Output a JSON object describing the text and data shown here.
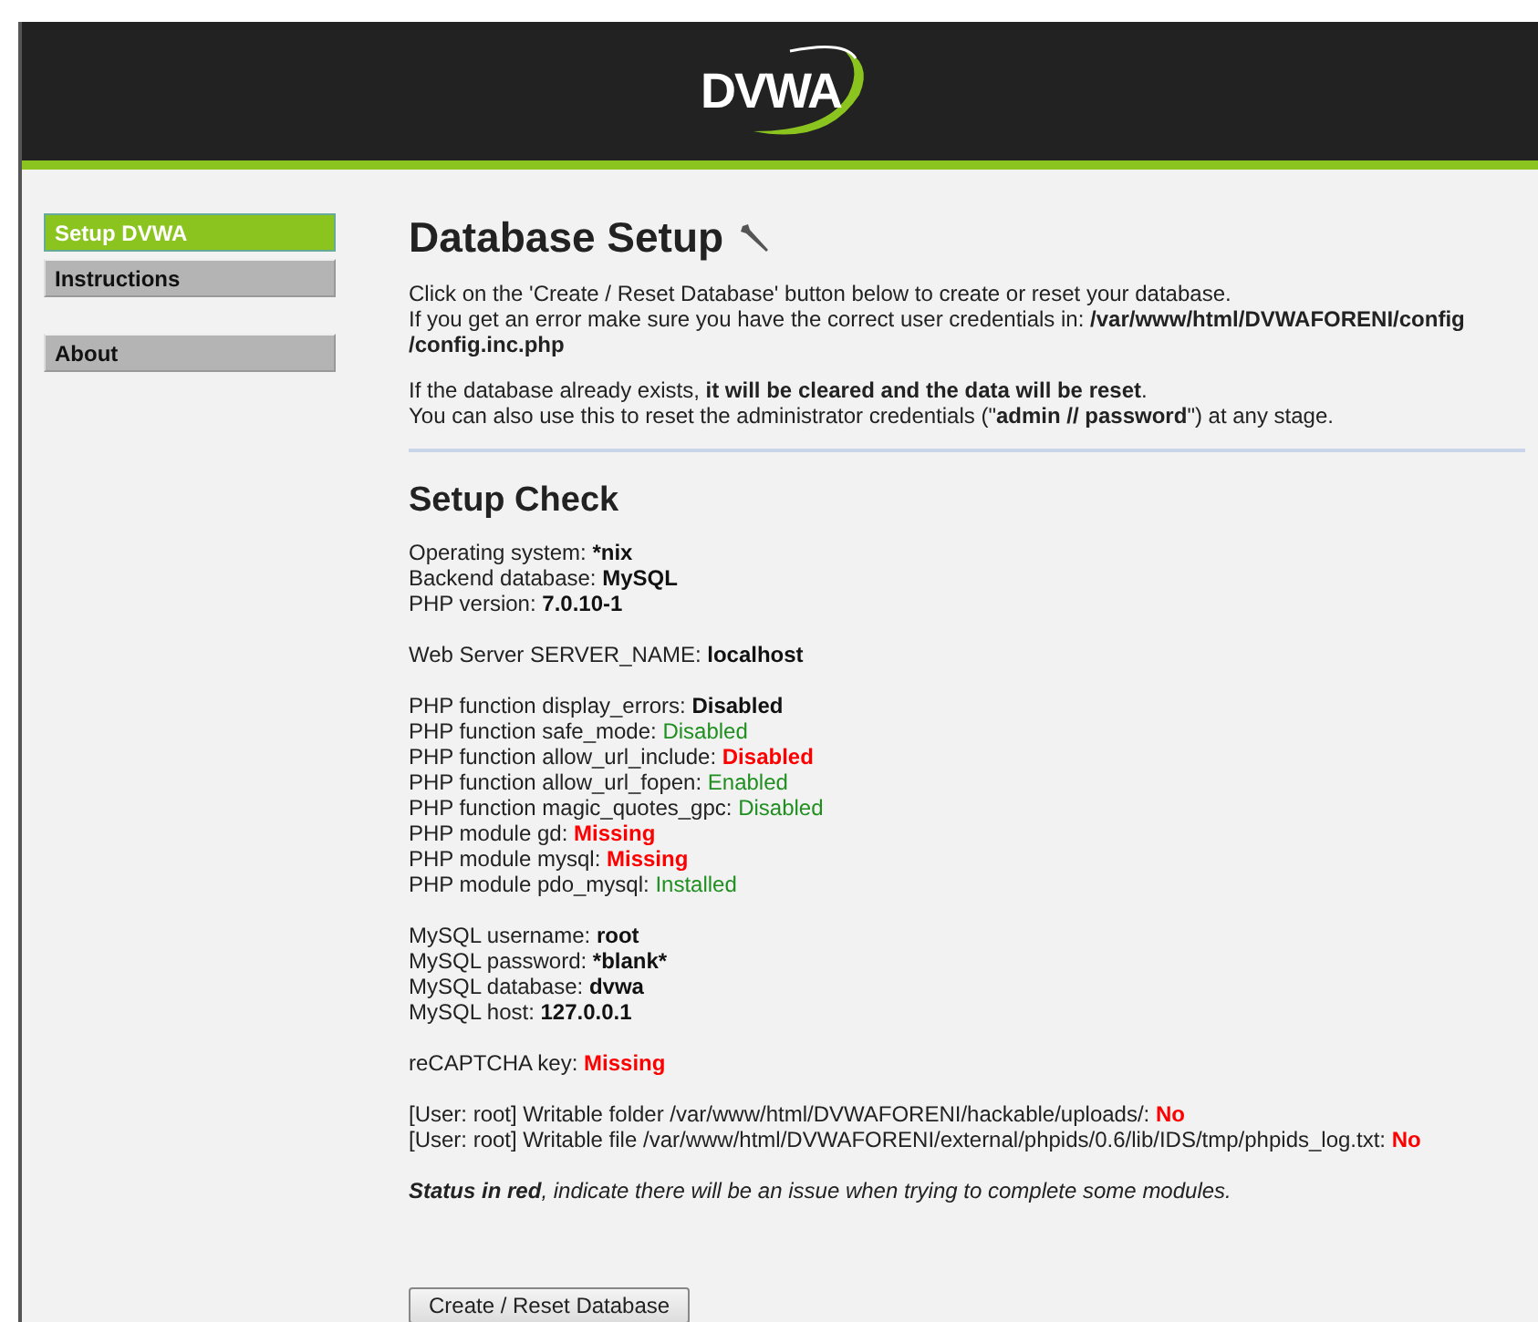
{
  "header": {
    "logo": "DVWA"
  },
  "menu": [
    [
      {
        "label": "Setup DVWA",
        "selected": true
      },
      {
        "label": "Instructions",
        "selected": false
      }
    ],
    [
      {
        "label": "About",
        "selected": false
      }
    ]
  ],
  "title": "Database Setup",
  "intro": [
    [
      "Click on the 'Create / Reset Database' button below to create or reset your database.",
      "If you get an error make sure you have the correct user credentials in: **/var/www/html/DVWAFORENI/config**",
      "**/config.inc.php**"
    ],
    [
      "If the database already exists, **it will be cleared and the data will be reset**.",
      "You can also use this to reset the administrator credentials (\"**admin // password**\") at any stage."
    ]
  ],
  "check_title": "Setup Check",
  "checks": [
    [
      {
        "label": "Operating system: ",
        "value": "*nix",
        "kind": "info"
      },
      {
        "label": "Backend database: ",
        "value": "MySQL",
        "kind": "info"
      },
      {
        "label": "PHP version: ",
        "value": "7.0.10-1",
        "kind": "info"
      }
    ],
    [
      {
        "label": "Web Server SERVER_NAME: ",
        "value": "localhost",
        "kind": "info"
      }
    ],
    [
      {
        "label": "PHP function display_errors: ",
        "value": "Disabled",
        "kind": "info"
      },
      {
        "label": "PHP function safe_mode: ",
        "value": "Disabled",
        "kind": "ok"
      },
      {
        "label": "PHP function allow_url_include: ",
        "value": "Disabled",
        "kind": "bad"
      },
      {
        "label": "PHP function allow_url_fopen: ",
        "value": "Enabled",
        "kind": "ok"
      },
      {
        "label": "PHP function magic_quotes_gpc: ",
        "value": "Disabled",
        "kind": "ok"
      },
      {
        "label": "PHP module gd: ",
        "value": "Missing",
        "kind": "bad"
      },
      {
        "label": "PHP module mysql: ",
        "value": "Missing",
        "kind": "bad"
      },
      {
        "label": "PHP module pdo_mysql: ",
        "value": "Installed",
        "kind": "ok"
      }
    ],
    [
      {
        "label": "MySQL username: ",
        "value": "root",
        "kind": "info"
      },
      {
        "label": "MySQL password: ",
        "value": "*blank*",
        "kind": "info"
      },
      {
        "label": "MySQL database: ",
        "value": "dvwa",
        "kind": "info"
      },
      {
        "label": "MySQL host: ",
        "value": "127.0.0.1",
        "kind": "info"
      }
    ],
    [
      {
        "label": "reCAPTCHA key: ",
        "value": "Missing",
        "kind": "bad"
      }
    ],
    [
      {
        "label": "[User: root] Writable folder /var/www/html/DVWAFORENI/hackable/uploads/: ",
        "value": "No",
        "kind": "bad"
      },
      {
        "label": "[User: root] Writable file /var/www/html/DVWAFORENI/external/phpids/0.6/lib/IDS/tmp/phpids_log.txt: ",
        "value": "No",
        "kind": "bad"
      }
    ]
  ],
  "note": "**Status in red**, indicate there will be an issue when trying to complete some modules.",
  "button": "Create / Reset Database"
}
